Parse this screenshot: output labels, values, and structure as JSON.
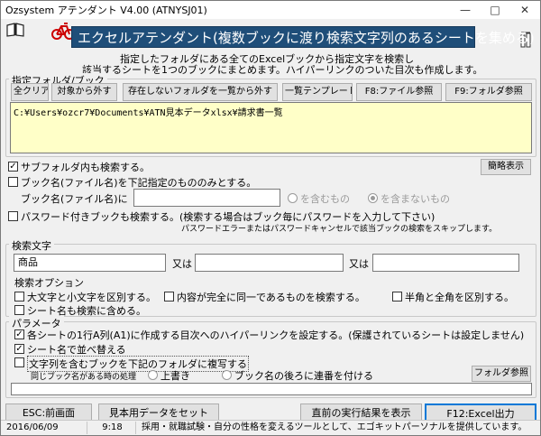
{
  "window": {
    "title": "Ozsystem アテンダント V4.00 (ATNYSJ01)"
  },
  "header": {
    "banner": "エクセルアテンダント(複数ブックに渡り検索文字列のあるシートを集める)",
    "description_line1": "指定したフォルダにある全てのExcelブックから指定文字を検索し",
    "description_line2": "該当するシートを1つのブックにまとめます。ハイパーリンクのついた目次も作成します。",
    "accent": "#1f4e79",
    "icons": [
      "book-icon",
      "bicycle-icon",
      "figures-icon"
    ]
  },
  "folder_group": {
    "legend": "指定フォルダ/ブック",
    "buttons": {
      "clear_all": "全クリア",
      "remove": "対象から外す",
      "remove_missing": "存在しないフォルダを一覧から外す",
      "template": "一覧テンプレート",
      "f8": "F8:ファイル参照",
      "f9": "F9:フォルダ参照"
    },
    "list_item": "C:¥Users¥ozcr7¥Documents¥ATN見本データxlsx¥請求書一覧"
  },
  "options": {
    "subfolder_label": "サブフォルダ内も検索する。",
    "subfolder_checked": "✓",
    "simple_display": "簡略表示",
    "book_name_limit_label": "ブック名(ファイル名)を下記指定のもののみとする。",
    "book_name_field_label": "ブック名(ファイル名)に",
    "book_name_value": "",
    "radio_contains": "を含むもの",
    "radio_not_contains": "を含まないもの",
    "password_label": "パスワード付きブックも検索する。(検索する場合はブック毎にパスワードを入力して下さい)",
    "password_note": "パスワードエラーまたはパスワードキャンセルで該当ブックの検索をスキップします。"
  },
  "search_group": {
    "legend": "検索文字",
    "term1": "商品",
    "or1": "又は",
    "term2": "",
    "or2": "又は",
    "term3": "",
    "options_title": "検索オプション",
    "case_label": "大文字と小文字を区別する。",
    "exact_label": "内容が完全に同一であるものを検索する。",
    "width_label": "半角と全角を区別する。",
    "names_label": "シート名も検索に含める。"
  },
  "params_group": {
    "legend": "パラメータ",
    "hyperlink_label": "各シートの1行A列(A1)に作成する目次へのハイパーリンクを設定する。(保護されているシートは設定しません)",
    "hyperlink_checked": "✓",
    "sort_label": "シート名で並べ替える",
    "sort_checked": "✓",
    "copy_label": "文字列を含むブックを下記のフォルダに複写する",
    "same_name_label": "同じブック名がある時の処理",
    "overwrite_label": "上書き",
    "serial_label": "ブック名の後ろに連番を付ける",
    "folder_ref": "フォルダ参照",
    "copy_folder_value": ""
  },
  "footer": {
    "esc": "ESC:前画面",
    "sample": "見本用データをセット",
    "last_result": "直前の実行結果を表示",
    "f12": "F12:Excel出力"
  },
  "status": {
    "date": "2016/06/09",
    "time": "9:18",
    "message": "採用・就職試験・自分の性格を変えるツールとして、エゴキットパーソナルを提供しています。"
  }
}
